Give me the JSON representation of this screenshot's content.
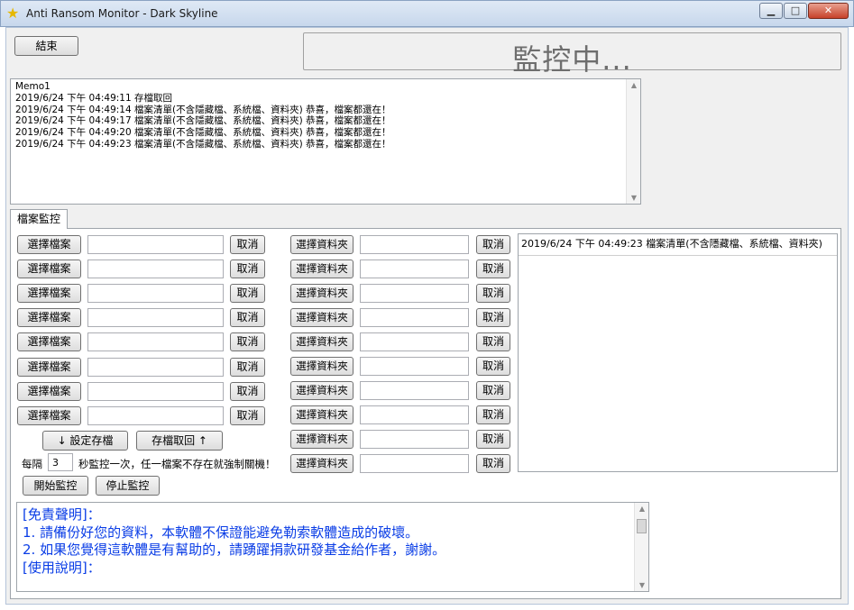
{
  "window": {
    "title": "Anti Ransom Monitor - Dark Skyline",
    "min_glyph": "▁",
    "max_glyph": "□",
    "close_glyph": "✕"
  },
  "toolbar": {
    "end_label": "結束"
  },
  "status": {
    "text": "監控中..."
  },
  "memo": {
    "lines": [
      "Memo1",
      "2019/6/24 下午 04:49:11 存檔取回",
      "2019/6/24 下午 04:49:14 檔案清單(不含隱藏檔、系統檔、資料夾) 恭喜，檔案都還在！",
      "2019/6/24 下午 04:49:17 檔案清單(不含隱藏檔、系統檔、資料夾) 恭喜，檔案都還在！",
      "2019/6/24 下午 04:49:20 檔案清單(不含隱藏檔、系統檔、資料夾) 恭喜，檔案都還在！",
      "2019/6/24 下午 04:49:23 檔案清單(不含隱藏檔、系統檔、資料夾) 恭喜，檔案都還在！"
    ]
  },
  "tab": {
    "label": "檔案監控"
  },
  "files": {
    "select_label": "選擇檔案",
    "cancel_label": "取消",
    "rows": [
      {
        "path": ""
      },
      {
        "path": ""
      },
      {
        "path": ""
      },
      {
        "path": ""
      },
      {
        "path": ""
      },
      {
        "path": ""
      },
      {
        "path": ""
      },
      {
        "path": ""
      }
    ]
  },
  "folders": {
    "select_label": "選擇資料夾",
    "cancel_label": "取消",
    "rows": [
      {
        "path": ""
      },
      {
        "path": ""
      },
      {
        "path": ""
      },
      {
        "path": ""
      },
      {
        "path": ""
      },
      {
        "path": ""
      },
      {
        "path": ""
      },
      {
        "path": ""
      },
      {
        "path": ""
      },
      {
        "path": ""
      }
    ]
  },
  "storage": {
    "save_label": "↓ 設定存檔",
    "load_label": "存檔取回 ↑"
  },
  "interval": {
    "prefix": "每隔",
    "value": "3",
    "suffix": "秒監控一次，任一檔案不存在就強制關機！"
  },
  "controls": {
    "start_label": "開始監控",
    "stop_label": "停止監控"
  },
  "log_list": {
    "header": "2019/6/24 下午 04:49:23 檔案清單(不含隱藏檔、系統檔、資料夾)"
  },
  "notes": {
    "lines": [
      "[免責聲明]：",
      "1. 請備份好您的資料，本軟體不保證能避免勒索軟體造成的破壞。",
      "2. 如果您覺得這軟體是有幫助的，請踴躍捐款研發基金給作者，謝謝。",
      "[使用說明]："
    ]
  }
}
